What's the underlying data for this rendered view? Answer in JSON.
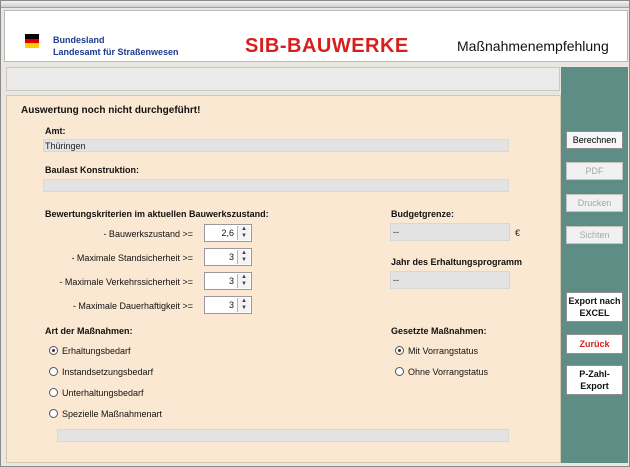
{
  "header": {
    "org_line1": "Bundesland",
    "org_line2": "Landesamt für Straßenwesen",
    "app_title": "SIB-BAUWERKE",
    "subtitle": "Maßnahmenempfehlung"
  },
  "status": "Auswertung noch nicht durchgeführt!",
  "amt": {
    "label": "Amt:",
    "value": "Thüringen"
  },
  "baulast": {
    "label": "Baulast Konstruktion:",
    "value": ""
  },
  "criteria": {
    "label": "Bewertungskriterien im aktuellen Bauwerkszustand:",
    "rows": [
      {
        "label": "- Bauwerkszustand >=",
        "value": "2,6"
      },
      {
        "label": "- Maximale Standsicherheit >=",
        "value": "3"
      },
      {
        "label": "- Maximale Verkehrssicherheit >=",
        "value": "3"
      },
      {
        "label": "- Maximale Dauerhaftigkeit >=",
        "value": "3"
      }
    ]
  },
  "budget": {
    "label": "Budgetgrenze:",
    "value": "--",
    "unit": "€"
  },
  "jahr": {
    "label": "Jahr des Erhaltungsprogramm",
    "value": "--"
  },
  "art": {
    "label": "Art der Maßnahmen:",
    "options": [
      "Erhaltungsbedarf",
      "Instandsetzungsbedarf",
      "Unterhaltungsbedarf",
      "Spezielle Maßnahmenart"
    ],
    "selected": 0,
    "special_value": ""
  },
  "gesetzt": {
    "label": "Gesetzte Maßnahmen:",
    "options": [
      "Mit Vorrangstatus",
      "Ohne Vorrangstatus"
    ],
    "selected": 0
  },
  "buttons": {
    "berechnen": "Berechnen",
    "pdf": "PDF",
    "drucken": "Drucken",
    "sichten": "Sichten",
    "export_line1": "Export nach",
    "export_line2": "EXCEL",
    "zurueck": "Zurück",
    "pzahl_line1": "P-Zahl-",
    "pzahl_line2": "Export"
  },
  "colors": {
    "accent_red": "#d61f1f",
    "panel": "#fbe8d2",
    "sidebar": "#5e8d86",
    "org_blue": "#1b3b8f"
  }
}
